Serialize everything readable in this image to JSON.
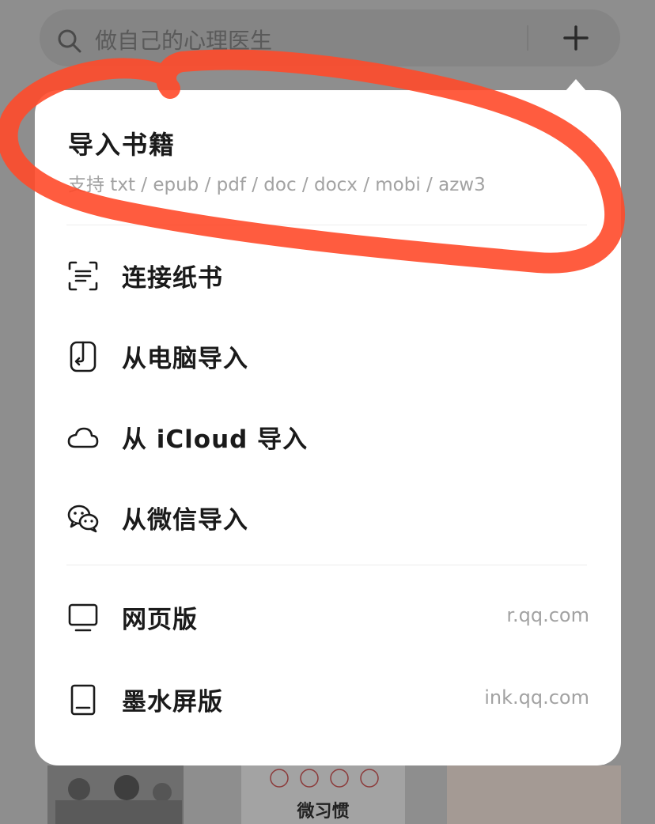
{
  "search": {
    "placeholder": "做自己的心理医生"
  },
  "popup": {
    "title": "导入书籍",
    "subtitle": "支持 txt / epub / pdf / doc / docx / mobi / azw3",
    "items": [
      {
        "label": "连接纸书",
        "icon": "scan-icon"
      },
      {
        "label": "从电脑导入",
        "icon": "phone-import-icon"
      },
      {
        "label": "从 iCloud 导入",
        "icon": "cloud-icon"
      },
      {
        "label": "从微信导入",
        "icon": "wechat-icon"
      }
    ],
    "links": [
      {
        "label": "网页版",
        "url": "r.qq.com",
        "icon": "monitor-icon"
      },
      {
        "label": "墨水屏版",
        "url": "ink.qq.com",
        "icon": "ereader-icon"
      }
    ]
  },
  "books": [
    {
      "title": "微习惯"
    }
  ],
  "colors": {
    "annotation": "#ff4a2a",
    "overlay": "#8e8e8e",
    "popup_bg": "#ffffff"
  }
}
